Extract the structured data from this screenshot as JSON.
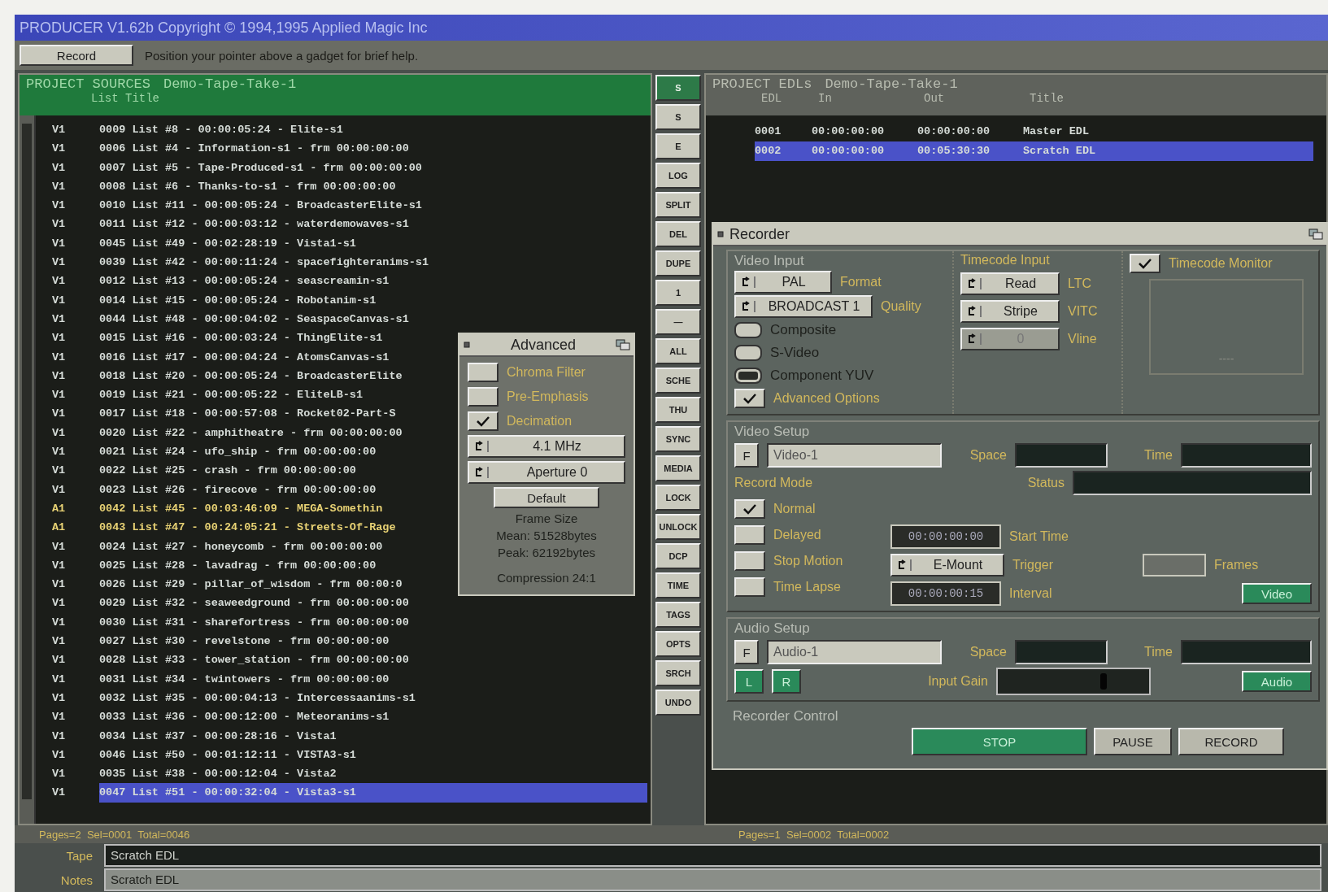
{
  "window": {
    "title": "PRODUCER V1.62b Copyright © 1994,1995 Applied Magic Inc"
  },
  "toolbar": {
    "button": "Record",
    "help": "Position your pointer above a gadget for brief help."
  },
  "sources": {
    "title": "PROJECT SOURCES",
    "project": "Demo-Tape-Take-1",
    "column": "List Title",
    "status": "Pages=2  Sel=0001  Total=0046",
    "rows": [
      {
        "track": "V1",
        "text": "0009 List #8 - 00:00:05:24 - Elite-s1",
        "color": "#d6dcd8",
        "selected": false
      },
      {
        "track": "V1",
        "text": "0006 List #4 - Information-s1 - frm 00:00:00:00",
        "color": "#d6dcd8",
        "selected": false
      },
      {
        "track": "V1",
        "text": "0007 List #5 - Tape-Produced-s1 - frm 00:00:00:00",
        "color": "#d6dcd8",
        "selected": false
      },
      {
        "track": "V1",
        "text": "0008 List #6 - Thanks-to-s1 - frm 00:00:00:00",
        "color": "#d6dcd8",
        "selected": false
      },
      {
        "track": "V1",
        "text": "0010 List #11 - 00:00:05:24 - BroadcasterElite-s1",
        "color": "#d6dcd8",
        "selected": false
      },
      {
        "track": "V1",
        "text": "0011 List #12 - 00:00:03:12 - waterdemowaves-s1",
        "color": "#d6dcd8",
        "selected": false
      },
      {
        "track": "V1",
        "text": "0045 List #49 - 00:02:28:19 - Vista1-s1",
        "color": "#d6dcd8",
        "selected": false
      },
      {
        "track": "V1",
        "text": "0039 List #42 - 00:00:11:24 - spacefighteranims-s1",
        "color": "#d6dcd8",
        "selected": false
      },
      {
        "track": "V1",
        "text": "0012 List #13 - 00:00:05:24 - seascreamin-s1",
        "color": "#d6dcd8",
        "selected": false
      },
      {
        "track": "V1",
        "text": "0014 List #15 - 00:00:05:24 - Robotanim-s1",
        "color": "#d6dcd8",
        "selected": false
      },
      {
        "track": "V1",
        "text": "0044 List #48 - 00:00:04:02 - SeaspaceCanvas-s1",
        "color": "#d6dcd8",
        "selected": false
      },
      {
        "track": "V1",
        "text": "0015 List #16 - 00:00:03:24 - ThingElite-s1",
        "color": "#d6dcd8",
        "selected": false
      },
      {
        "track": "V1",
        "text": "0016 List #17 - 00:00:04:24 - AtomsCanvas-s1",
        "color": "#d6dcd8",
        "selected": false
      },
      {
        "track": "V1",
        "text": "0018 List #20 - 00:00:05:24 - BroadcasterElite",
        "color": "#d6dcd8",
        "selected": false
      },
      {
        "track": "V1",
        "text": "0019 List #21 - 00:00:05:22 - EliteLB-s1",
        "color": "#d6dcd8",
        "selected": false
      },
      {
        "track": "V1",
        "text": "0017 List #18 - 00:00:57:08 - Rocket02-Part-S",
        "color": "#d6dcd8",
        "selected": false
      },
      {
        "track": "V1",
        "text": "0020 List #22 - amphitheatre - frm 00:00:00:00",
        "color": "#d6dcd8",
        "selected": false
      },
      {
        "track": "V1",
        "text": "0021 List #24 - ufo_ship - frm 00:00:00:00",
        "color": "#d6dcd8",
        "selected": false
      },
      {
        "track": "V1",
        "text": "0022 List #25 - crash - frm 00:00:00:00",
        "color": "#d6dcd8",
        "selected": false
      },
      {
        "track": "V1",
        "text": "0023 List #26 - firecove - frm 00:00:00:00",
        "color": "#d6dcd8",
        "selected": false
      },
      {
        "track": "A1",
        "text": "0042 List #45 - 00:03:46:09 - MEGA-Somethin",
        "color": "#e8d274",
        "selected": false
      },
      {
        "track": "A1",
        "text": "0043 List #47 - 00:24:05:21 - Streets-Of-Rage",
        "color": "#e8d274",
        "selected": false
      },
      {
        "track": "V1",
        "text": "0024 List #27 - honeycomb - frm 00:00:00:00",
        "color": "#d6dcd8",
        "selected": false
      },
      {
        "track": "V1",
        "text": "0025 List #28 - lavadrag - frm 00:00:00:00",
        "color": "#d6dcd8",
        "selected": false
      },
      {
        "track": "V1",
        "text": "0026 List #29 - pillar_of_wisdom - frm 00:00:0",
        "color": "#d6dcd8",
        "selected": false
      },
      {
        "track": "V1",
        "text": "0029 List #32 - seaweedground - frm 00:00:00:00",
        "color": "#d6dcd8",
        "selected": false
      },
      {
        "track": "V1",
        "text": "0030 List #31 - sharefortress - frm 00:00:00:00",
        "color": "#d6dcd8",
        "selected": false
      },
      {
        "track": "V1",
        "text": "0027 List #30 - revelstone - frm 00:00:00:00",
        "color": "#d6dcd8",
        "selected": false
      },
      {
        "track": "V1",
        "text": "0028 List #33 - tower_station - frm 00:00:00:00",
        "color": "#d6dcd8",
        "selected": false
      },
      {
        "track": "V1",
        "text": "0031 List #34 - twintowers - frm 00:00:00:00",
        "color": "#d6dcd8",
        "selected": false
      },
      {
        "track": "V1",
        "text": "0032 List #35 - 00:00:04:13 - Intercessaanims-s1",
        "color": "#d6dcd8",
        "selected": false
      },
      {
        "track": "V1",
        "text": "0033 List #36 - 00:00:12:00 - Meteoranims-s1",
        "color": "#d6dcd8",
        "selected": false
      },
      {
        "track": "V1",
        "text": "0034 List #37 - 00:00:28:16 - Vista1",
        "color": "#d6dcd8",
        "selected": false
      },
      {
        "track": "V1",
        "text": "0046 List #50 - 00:01:12:11 - VISTA3-s1",
        "color": "#d6dcd8",
        "selected": false
      },
      {
        "track": "V1",
        "text": "0035 List #38 - 00:00:12:04 - Vista2",
        "color": "#d6dcd8",
        "selected": false
      },
      {
        "track": "V1",
        "text": "0047 List #51 - 00:00:32:04 - Vista3-s1",
        "color": "#d6dcd8",
        "selected": true
      }
    ]
  },
  "tools": [
    {
      "label": "S",
      "selected": true
    },
    {
      "label": "S",
      "selected": false
    },
    {
      "label": "E",
      "selected": false
    },
    {
      "label": "LOG",
      "selected": false
    },
    {
      "label": "SPLIT",
      "selected": false
    },
    {
      "label": "DEL",
      "selected": false
    },
    {
      "label": "DUPE",
      "selected": false
    },
    {
      "label": "1",
      "selected": false
    },
    {
      "label": "—",
      "selected": false
    },
    {
      "label": "ALL",
      "selected": false
    },
    {
      "label": "SCHE",
      "selected": false
    },
    {
      "label": "THU",
      "selected": false
    },
    {
      "label": "SYNC",
      "selected": false
    },
    {
      "label": "MEDIA",
      "selected": false
    },
    {
      "label": "LOCK",
      "selected": false
    },
    {
      "label": "UNLOCK",
      "selected": false
    },
    {
      "label": "DCP",
      "selected": false
    },
    {
      "label": "TIME",
      "selected": false
    },
    {
      "label": "TAGS",
      "selected": false
    },
    {
      "label": "OPTS",
      "selected": false
    },
    {
      "label": "SRCH",
      "selected": false
    },
    {
      "label": "UNDO",
      "selected": false
    }
  ],
  "edls": {
    "title": "PROJECT EDLs",
    "project": "Demo-Tape-Take-1",
    "columns": [
      "EDL",
      "In",
      "Out",
      "Title"
    ],
    "status": "Pages=1  Sel=0002  Total=0002",
    "rows": [
      {
        "cells": [
          "0001",
          "00:00:00:00",
          "00:00:00:00",
          "Master EDL"
        ],
        "selected": false
      },
      {
        "cells": [
          "0002",
          "00:00:00:00",
          "00:05:30:30",
          "Scratch EDL"
        ],
        "selected": true
      }
    ]
  },
  "advanced": {
    "title": "Advanced",
    "options": [
      {
        "label": "Chroma Filter",
        "checked": false
      },
      {
        "label": "Pre-Emphasis",
        "checked": false
      },
      {
        "label": "Decimation",
        "checked": true
      }
    ],
    "cycles": [
      "4.1 MHz",
      "Aperture 0"
    ],
    "default_button": "Default",
    "frame_size": "Frame Size",
    "mean": "Mean: 51528bytes",
    "peak": "Peak: 62192bytes",
    "compression": "Compression 24:1"
  },
  "recorder": {
    "title": "Recorder",
    "video_input": {
      "title": "Video Input",
      "cycles": [
        {
          "value": "PAL",
          "label": "Format"
        },
        {
          "value": "BROADCAST 1",
          "label": "Quality"
        }
      ],
      "sources": [
        {
          "label": "Composite",
          "selected": false
        },
        {
          "label": "S-Video",
          "selected": false
        },
        {
          "label": "Component YUV",
          "selected": true
        }
      ],
      "advanced_options": {
        "label": "Advanced Options",
        "checked": true
      }
    },
    "timecode_input": {
      "title": "Timecode Input",
      "buttons": [
        {
          "value": "Read",
          "label": "LTC",
          "disabled": false
        },
        {
          "value": "Stripe",
          "label": "VITC",
          "disabled": false
        },
        {
          "value": "0",
          "label": "Vline",
          "disabled": true
        }
      ]
    },
    "timecode_monitor": {
      "label": "Timecode Monitor",
      "checked": true,
      "display": "----"
    },
    "video_setup": {
      "title": "Video Setup",
      "file_button": "F",
      "name": "Video-1",
      "space_label": "Space",
      "time_label": "Time",
      "record_mode": "Record Mode",
      "status_label": "Status",
      "modes": [
        {
          "label": "Normal",
          "checked": true
        },
        {
          "label": "Delayed",
          "checked": false
        },
        {
          "label": "Stop Motion",
          "checked": false
        },
        {
          "label": "Time Lapse",
          "checked": false
        }
      ],
      "start_time": {
        "value": "00:00:00:00",
        "label": "Start Time"
      },
      "trigger": {
        "value": "E-Mount",
        "label": "Trigger"
      },
      "frames": {
        "label": "Frames"
      },
      "interval": {
        "value": "00:00:00:15",
        "label": "Interval"
      },
      "channel_button": {
        "label": "Video",
        "on": true
      }
    },
    "audio_setup": {
      "title": "Audio Setup",
      "file_button": "F",
      "name": "Audio-1",
      "space_label": "Space",
      "time_label": "Time",
      "channels": [
        {
          "label": "L",
          "on": true
        },
        {
          "label": "R",
          "on": true
        }
      ],
      "gain": {
        "label": "Input Gain",
        "level": 0.68
      },
      "channel_button": {
        "label": "Audio",
        "on": true
      }
    },
    "control": {
      "title": "Recorder Control",
      "buttons": [
        {
          "label": "STOP",
          "active": true
        },
        {
          "label": "PAUSE",
          "active": false
        },
        {
          "label": "RECORD",
          "active": false
        }
      ]
    }
  },
  "tape": {
    "label": "Tape",
    "value": "Scratch EDL"
  },
  "notes": {
    "label": "Notes",
    "value": "Scratch EDL"
  }
}
